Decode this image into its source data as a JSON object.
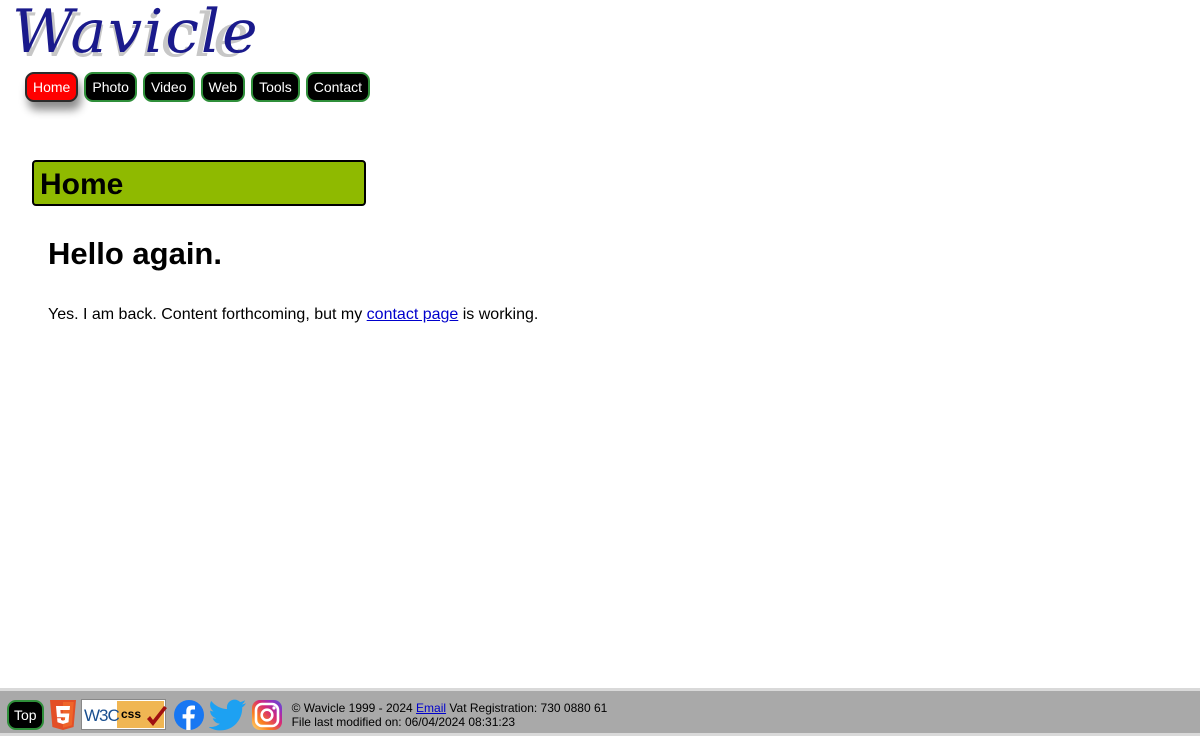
{
  "logo": {
    "text": "Wavicle",
    "color": "#1a1a8c"
  },
  "nav": {
    "items": [
      {
        "label": "Home",
        "active": true
      },
      {
        "label": "Photo"
      },
      {
        "label": "Video"
      },
      {
        "label": "Web"
      },
      {
        "label": "Tools"
      },
      {
        "label": "Contact"
      }
    ]
  },
  "section": {
    "title": "Home",
    "color": "#8fba00"
  },
  "content": {
    "heading": "Hello again.",
    "text_before": "Yes. I am back. Content forthcoming, but my ",
    "link_text": "contact page",
    "text_after": " is working."
  },
  "footer": {
    "top_label": "Top",
    "icons": [
      "html5-icon",
      "w3c-css-icon",
      "facebook-icon",
      "twitter-icon",
      "instagram-icon"
    ],
    "w3c_label": "W3C",
    "css_label": "css",
    "copyright": "© Wavicle 1999 - 2024",
    "email_label": "Email",
    "vat": "Vat Registration: 730 0880 61",
    "modified": "File last modified on: 06/04/2024 08:31:23"
  }
}
